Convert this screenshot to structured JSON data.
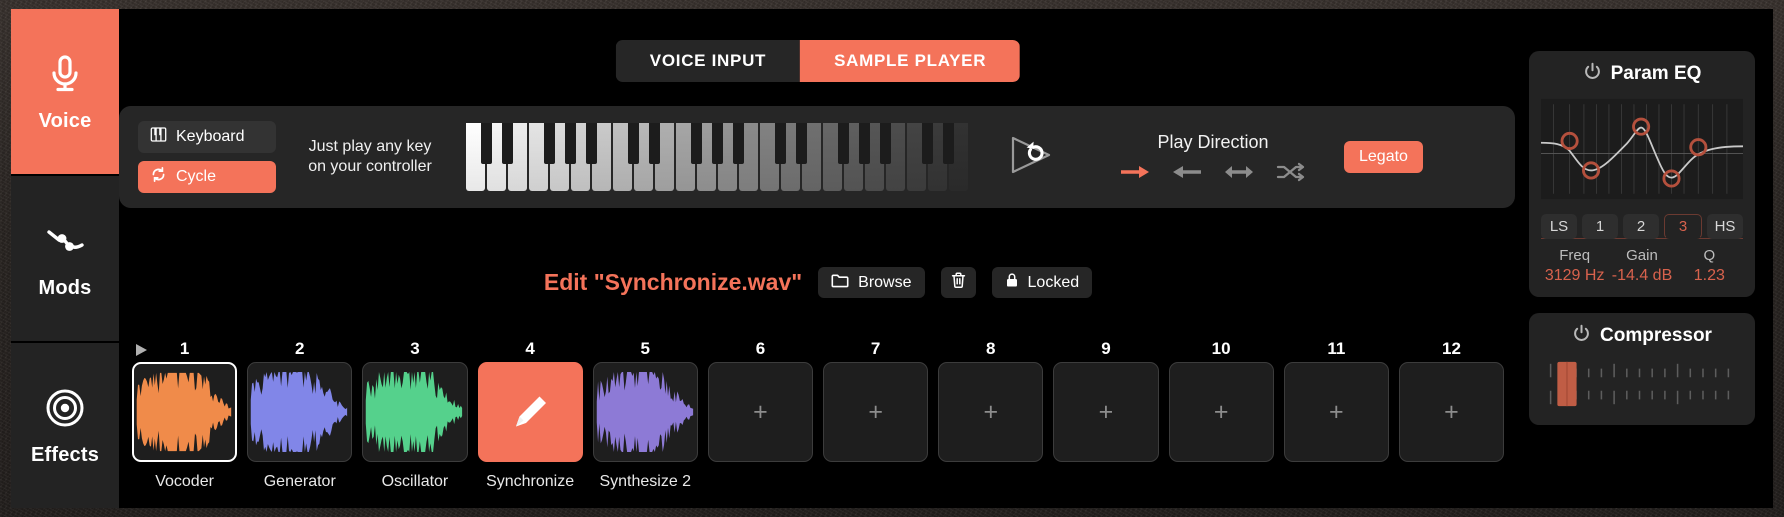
{
  "theme": {
    "accent": "#f4735a",
    "panel": "#262626",
    "screen_bg": "#000000",
    "eq_value": "#d8624d"
  },
  "sidebar": {
    "items": [
      {
        "label": "Voice",
        "icon": "microphone-icon",
        "active": true
      },
      {
        "label": "Mods",
        "icon": "modulation-curve-icon",
        "active": false
      },
      {
        "label": "Effects",
        "icon": "target-rings-icon",
        "active": false
      }
    ]
  },
  "top_tabs": [
    {
      "label": "VOICE INPUT",
      "active": false
    },
    {
      "label": "SAMPLE PLAYER",
      "active": true
    }
  ],
  "keyboard_panel": {
    "modes": [
      {
        "label": "Keyboard",
        "icon": "piano-keys-icon",
        "active": false
      },
      {
        "label": "Cycle",
        "icon": "cycle-arrows-icon",
        "active": true
      }
    ],
    "hint_line1": "Just play any key",
    "hint_line2": "on your controller",
    "loop_button_icon": "loop-play-icon",
    "play_direction": {
      "title": "Play Direction",
      "options": [
        {
          "icon": "arrow-right-icon",
          "name": "forward",
          "active": true
        },
        {
          "icon": "arrow-left-icon",
          "name": "reverse",
          "active": false
        },
        {
          "icon": "arrow-bidirectional-icon",
          "name": "pingpong",
          "active": false
        },
        {
          "icon": "shuffle-icon",
          "name": "random",
          "active": false
        }
      ]
    },
    "legato_label": "Legato"
  },
  "edit_row": {
    "title": "Edit \"Synchronize.wav\"",
    "browse_label": "Browse",
    "browse_icon": "folder-icon",
    "delete_icon": "trash-icon",
    "lock_label": "Locked",
    "lock_icon": "lock-icon"
  },
  "slots": {
    "playhead_icon": "play-triangle-icon",
    "items": [
      {
        "number": "1",
        "name": "Vocoder",
        "state": "waveform",
        "wave_color": "#f08b4a",
        "selected": true,
        "editing": false
      },
      {
        "number": "2",
        "name": "Generator",
        "state": "waveform",
        "wave_color": "#8186e8",
        "selected": false,
        "editing": false
      },
      {
        "number": "3",
        "name": "Oscillator",
        "state": "waveform",
        "wave_color": "#55d18c",
        "selected": false,
        "editing": false
      },
      {
        "number": "4",
        "name": "Synchronize",
        "state": "editing",
        "wave_color": "",
        "selected": false,
        "editing": true,
        "icon": "pencil-icon"
      },
      {
        "number": "5",
        "name": "Synthesize 2",
        "state": "waveform",
        "wave_color": "#8d7ad6",
        "selected": false,
        "editing": false
      },
      {
        "number": "6",
        "name": "",
        "state": "empty",
        "wave_color": "",
        "selected": false,
        "editing": false,
        "placeholder": "+"
      },
      {
        "number": "7",
        "name": "",
        "state": "empty",
        "wave_color": "",
        "selected": false,
        "editing": false,
        "placeholder": "+"
      },
      {
        "number": "8",
        "name": "",
        "state": "empty",
        "wave_color": "",
        "selected": false,
        "editing": false,
        "placeholder": "+"
      },
      {
        "number": "9",
        "name": "",
        "state": "empty",
        "wave_color": "",
        "selected": false,
        "editing": false,
        "placeholder": "+"
      },
      {
        "number": "10",
        "name": "",
        "state": "empty",
        "wave_color": "",
        "selected": false,
        "editing": false,
        "placeholder": "+"
      },
      {
        "number": "11",
        "name": "",
        "state": "empty",
        "wave_color": "",
        "selected": false,
        "editing": false,
        "placeholder": "+"
      },
      {
        "number": "12",
        "name": "",
        "state": "empty",
        "wave_color": "",
        "selected": false,
        "editing": false,
        "placeholder": "+"
      }
    ]
  },
  "rack": {
    "param_eq": {
      "title": "Param EQ",
      "power_icon": "power-icon",
      "tabs": [
        {
          "label": "LS",
          "active": false
        },
        {
          "label": "1",
          "active": false
        },
        {
          "label": "2",
          "active": false
        },
        {
          "label": "3",
          "active": true
        },
        {
          "label": "HS",
          "active": false
        }
      ],
      "params": [
        {
          "label": "Freq",
          "value": "3129 Hz"
        },
        {
          "label": "Gain",
          "value": "-14.4 dB"
        },
        {
          "label": "Q",
          "value": "1.23"
        }
      ]
    },
    "compressor": {
      "title": "Compressor",
      "power_icon": "power-icon",
      "meter_icon": "gain-reduction-meter"
    }
  }
}
